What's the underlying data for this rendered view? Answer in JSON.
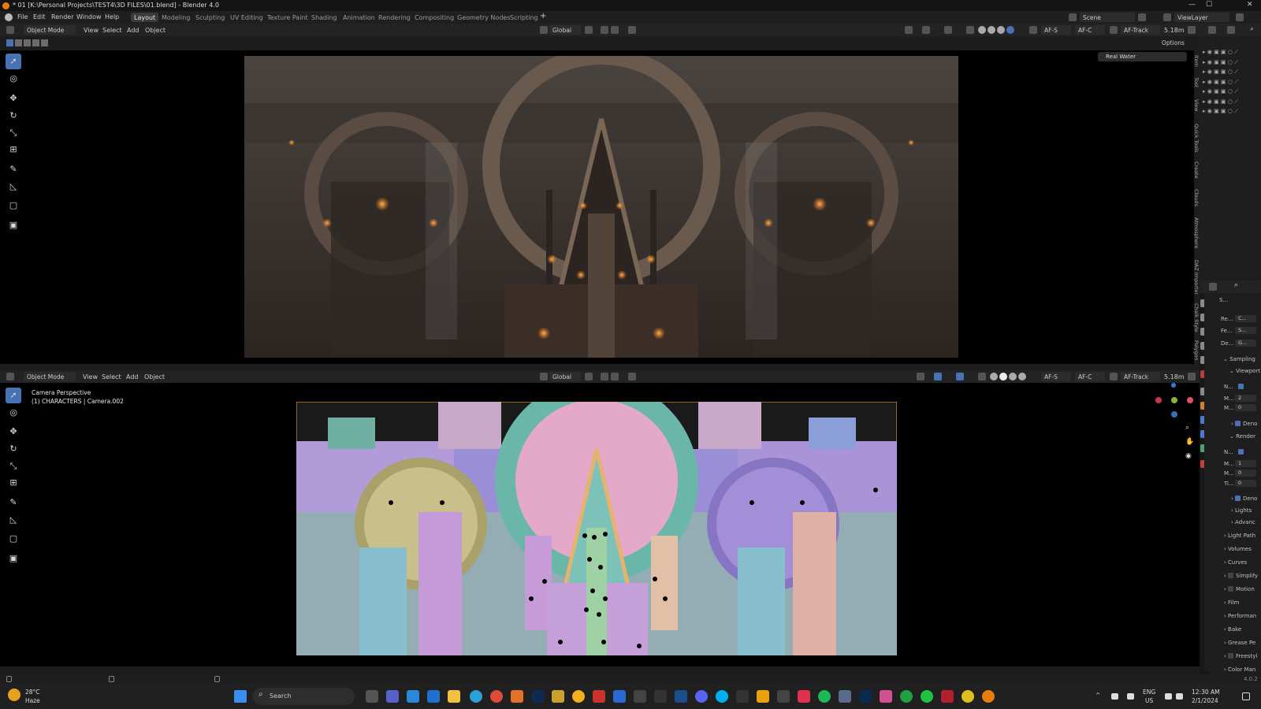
{
  "window": {
    "title": "* 01 [K:\\Personal Projects\\TEST4\\3D FILES\\01.blend] - Blender 4.0"
  },
  "menu": {
    "items": [
      "File",
      "Edit",
      "Render",
      "Window",
      "Help"
    ]
  },
  "workspaces": [
    "Layout",
    "Modeling",
    "Sculpting",
    "UV Editing",
    "Texture Paint",
    "Shading",
    "Animation",
    "Rendering",
    "Compositing",
    "Geometry Nodes",
    "Scripting"
  ],
  "scene": {
    "name": "Scene",
    "view_layer": "ViewLayer"
  },
  "header_top": {
    "mode": "Object Mode",
    "view": "View",
    "select": "Select",
    "add": "Add",
    "object": "Object",
    "orientation": "Global",
    "af_s": "AF-S",
    "af_c": "AF-C",
    "af_track": "AF-Track",
    "distance": "5.18m",
    "options": "Options"
  },
  "header_bottom": {
    "mode": "Object Mode",
    "view": "View",
    "select": "Select",
    "add": "Add",
    "object": "Object",
    "orientation": "Global",
    "af_s": "AF-S",
    "af_c": "AF-C",
    "af_track": "AF-Track",
    "distance": "5.18m"
  },
  "viewport_top": {
    "panel_label": "Real Water"
  },
  "viewport_bottom": {
    "overlay_title": "Camera Perspective",
    "overlay_subtitle": "(1) CHARACTERS | Camera.002"
  },
  "side_tabs": [
    "Item",
    "Tool",
    "View",
    "Quick Tools",
    "Create",
    "Clouds",
    "Atmosphere",
    "DAZ Importer",
    "Chalk Style",
    "Polygon"
  ],
  "properties": {
    "tab": "S...",
    "render_engine": {
      "label": "Re...",
      "value": "C..."
    },
    "feature_set": {
      "label": "Fe...",
      "value": "S..."
    },
    "device": {
      "label": "De...",
      "value": "G..."
    },
    "sampling": "Sampling",
    "viewport": "Viewport",
    "vp_noise": "N...",
    "vp_max": {
      "label": "M...",
      "value": "2"
    },
    "vp_min": {
      "label": "M...",
      "value": "0"
    },
    "vp_denoise": "Deno",
    "render": "Render",
    "r_noise": "N...",
    "r_max": {
      "label": "M...",
      "value": "1"
    },
    "r_min": {
      "label": "M...",
      "value": "0"
    },
    "r_time": {
      "label": "Ti...",
      "value": "0"
    },
    "r_denoise": "Deno",
    "lights": "Lights",
    "advanced": "Advanc",
    "sections": [
      "Light Path",
      "Volumes",
      "Curves",
      "Simplify",
      "Motion",
      "Film",
      "Performan",
      "Bake",
      "Grease Pe",
      "Freestyl",
      "Color Man"
    ]
  },
  "status": {
    "version": "4.0.2"
  },
  "taskbar": {
    "weather_temp": "28°C",
    "weather_desc": "Haze",
    "search": "Search",
    "lang": "ENG",
    "region": "US",
    "time": "12:30 AM",
    "date": "2/1/2024"
  },
  "colors": {
    "accent": "#4772b3",
    "bg": "#1d1d1d",
    "header": "#232323"
  }
}
